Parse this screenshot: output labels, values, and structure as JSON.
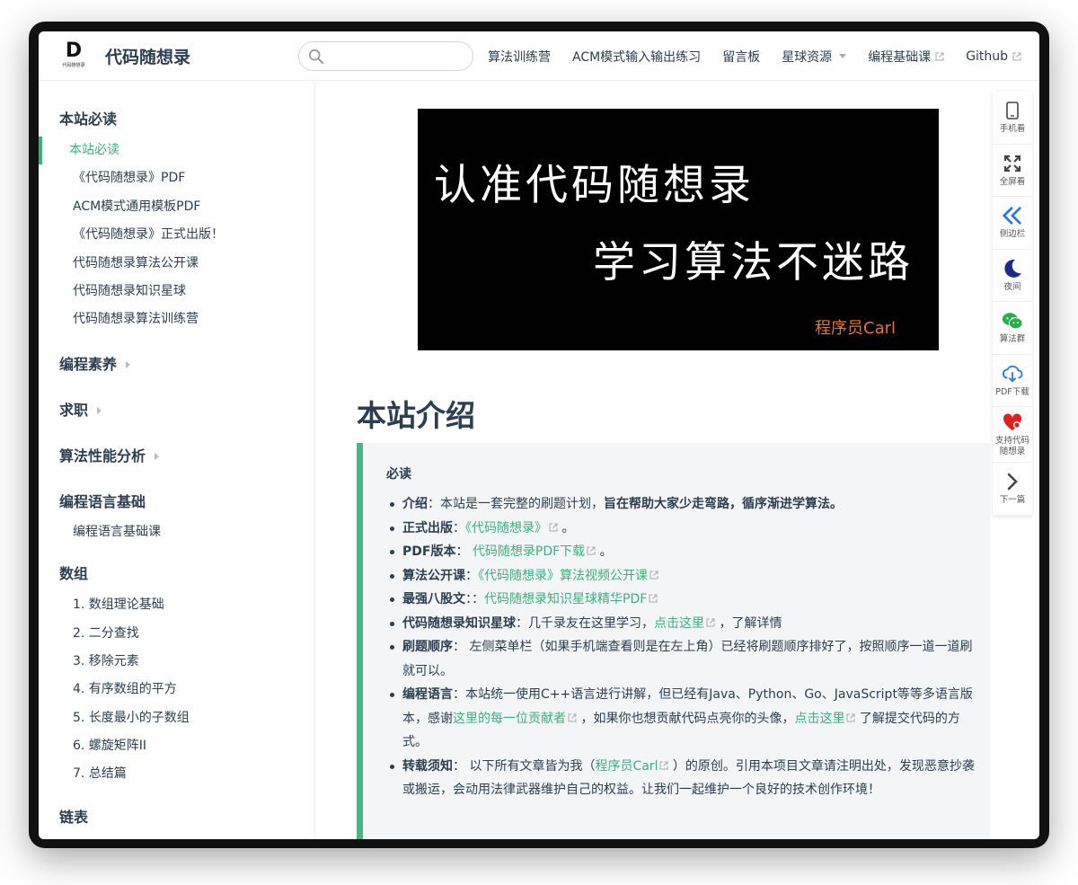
{
  "header": {
    "logo_letter": "D",
    "logo_small": "代码随想录",
    "site_name": "代码随想录",
    "search_placeholder": "",
    "nav": [
      {
        "label": "算法训练营"
      },
      {
        "label": "ACM模式输入输出练习"
      },
      {
        "label": "留言板"
      },
      {
        "label": "星球资源"
      },
      {
        "label": "编程基础课"
      },
      {
        "label": "Github"
      }
    ]
  },
  "sidebar": {
    "groups": [
      {
        "title": "本站必读",
        "items": [
          "本站必读",
          "《代码随想录》PDF",
          "ACM模式通用模板PDF",
          "《代码随想录》正式出版！",
          "代码随想录算法公开课",
          "代码随想录知识星球",
          "代码随想录算法训练营"
        ]
      },
      {
        "title": "编程素养"
      },
      {
        "title": "求职"
      },
      {
        "title": "算法性能分析"
      },
      {
        "title": "编程语言基础",
        "items": [
          "编程语言基础课"
        ]
      },
      {
        "title": "数组",
        "items": [
          "1. 数组理论基础",
          "2. 二分查找",
          "3. 移除元素",
          "4. 有序数组的平方",
          "5. 长度最小的子数组",
          "6. 螺旋矩阵II",
          "7. 总结篇"
        ]
      },
      {
        "title": "链表"
      }
    ]
  },
  "banner": {
    "line1": "认准代码随想录",
    "line2": "学习算法不迷路",
    "signature": "程序员Carl"
  },
  "main": {
    "title": "本站介绍",
    "tip_title": "必读",
    "items": [
      {
        "label": "介绍",
        "sep": "：",
        "text": "本站是一套完整的刷题计划，",
        "bold_text": "旨在帮助大家少走弯路，循序渐进学算法。"
      },
      {
        "label": "正式出版",
        "sep": "：",
        "link": "《代码随想录》",
        "after": " 。"
      },
      {
        "label": "PDF版本",
        "sep": "： ",
        "link": "代码随想录PDF下载",
        "after": " 。"
      },
      {
        "label": "算法公开课",
        "sep": "：",
        "link": "《代码随想录》算法视频公开课"
      },
      {
        "label": "最强八股文",
        "sep": "：：",
        "link": "代码随想录知识星球精华PDF"
      },
      {
        "label": "代码随想录知识星球",
        "sep": "：",
        "text": "几千录友在这里学习，",
        "link": "点击这里",
        "after": " ，了解详情"
      },
      {
        "label": "刷题顺序",
        "sep": "：",
        "text": " 左侧菜单栏（如果手机端查看则是在左上角）已经将刷题顺序排好了，按照顺序一道一道刷就可以。"
      },
      {
        "label": "编程语言",
        "sep": "：",
        "text": "本站统一使用C++语言进行讲解，但已经有Java、Python、Go、JavaScript等等多语言版本，感谢",
        "link": "这里的每一位贡献者",
        "text2": " ，如果你也想贡献代码点亮你的头像，",
        "link2": "点击这里",
        "after": " 了解提交代码的方式。"
      },
      {
        "label": "转载须知",
        "sep": "：",
        "text": " 以下所有文章皆为我（",
        "link": "程序员Carl",
        "after": " ）的原创。引用本项目文章请注明出处，发现恶意抄袭或搬运，会动用法律武器维护自己的权益。让我们一起维护一个良好的技术创作环境！"
      }
    ]
  },
  "toolbar": [
    {
      "label": "手机看",
      "icon": "phone-icon"
    },
    {
      "label": "全屏看",
      "icon": "fullscreen-icon"
    },
    {
      "label": "侧边栏",
      "icon": "sidebar-toggle-icon"
    },
    {
      "label": "夜间",
      "icon": "moon-icon"
    },
    {
      "label": "算法群",
      "icon": "wechat-icon"
    },
    {
      "label": "PDF下载",
      "icon": "cloud-download-icon"
    },
    {
      "label": "支持代码随想录",
      "icon": "heart-icon"
    },
    {
      "label": "下一篇",
      "icon": "chevron-right-icon"
    }
  ],
  "colors": {
    "accent": "#3eaf7c",
    "tip_border": "#42b983",
    "tip_bg": "#f3f5f7",
    "text": "#2c3e50",
    "banner_bg": "#000000",
    "banner_signature": "#e8762b"
  }
}
